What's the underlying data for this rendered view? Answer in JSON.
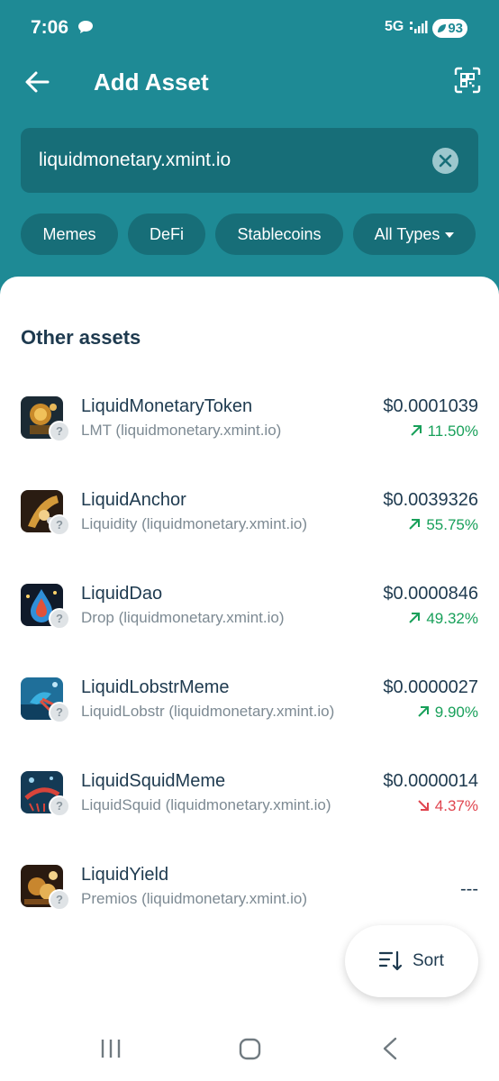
{
  "status_bar": {
    "time": "7:06",
    "network": "5G",
    "battery": "93"
  },
  "header": {
    "title": "Add Asset"
  },
  "search": {
    "value": "liquidmonetary.xmint.io"
  },
  "filters": [
    "Memes",
    "DeFi",
    "Stablecoins",
    "All Types"
  ],
  "section_title": "Other assets",
  "assets": [
    {
      "name": "LiquidMonetaryToken",
      "subtitle": "LMT (liquidmonetary.xmint.io)",
      "price": "$0.0001039",
      "change": "11.50%",
      "direction": "up"
    },
    {
      "name": "LiquidAnchor",
      "subtitle": "Liquidity (liquidmonetary.xmint.io)",
      "price": "$0.0039326",
      "change": "55.75%",
      "direction": "up"
    },
    {
      "name": "LiquidDao",
      "subtitle": "Drop (liquidmonetary.xmint.io)",
      "price": "$0.0000846",
      "change": "49.32%",
      "direction": "up"
    },
    {
      "name": "LiquidLobstrMeme",
      "subtitle": "LiquidLobstr (liquidmonetary.xmint.io)",
      "price": "$0.0000027",
      "change": "9.90%",
      "direction": "up"
    },
    {
      "name": "LiquidSquidMeme",
      "subtitle": "LiquidSquid (liquidmonetary.xmint.io)",
      "price": "$0.0000014",
      "change": "4.37%",
      "direction": "down"
    },
    {
      "name": "LiquidYield",
      "subtitle": "Premios (liquidmonetary.xmint.io)",
      "price": "---"
    }
  ],
  "unknown_badge": "?",
  "sort": {
    "label": "Sort"
  },
  "colors": {
    "header": "#1e8a95",
    "up": "#18a05a",
    "down": "#e0454f",
    "text": "#1e3a4f"
  }
}
